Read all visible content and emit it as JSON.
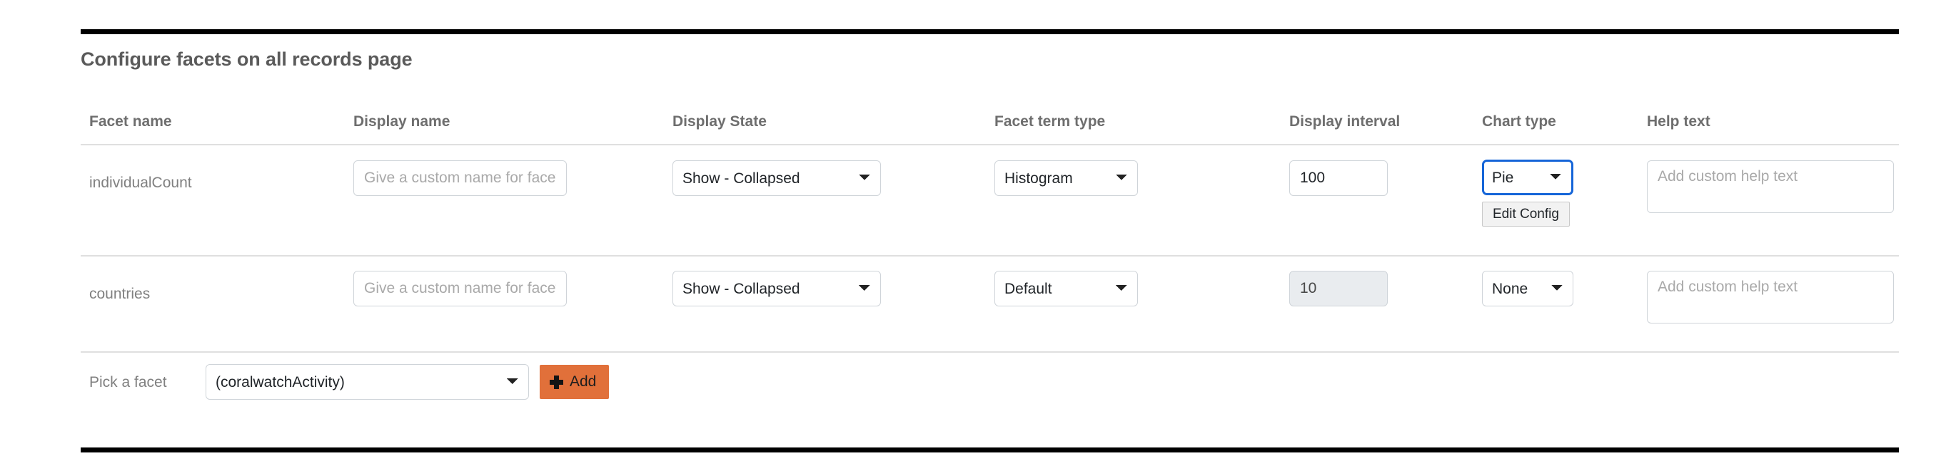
{
  "page": {
    "title": "Configure facets on all records page"
  },
  "table": {
    "columns": [
      {
        "key": "facet_name",
        "label": "Facet name"
      },
      {
        "key": "display_name",
        "label": "Display name"
      },
      {
        "key": "display_state",
        "label": "Display State"
      },
      {
        "key": "facet_term_type",
        "label": "Facet term type"
      },
      {
        "key": "display_interval",
        "label": "Display interval"
      },
      {
        "key": "chart_type",
        "label": "Chart type"
      },
      {
        "key": "help_text",
        "label": "Help text"
      }
    ],
    "rows": [
      {
        "facet_name": "individualCount",
        "display_name": {
          "value": "",
          "placeholder": "Give a custom name for facet."
        },
        "display_state": {
          "selected": "Show - Collapsed"
        },
        "facet_term_type": {
          "selected": "Histogram"
        },
        "display_interval": {
          "value": "100",
          "readonly": false
        },
        "chart_type": {
          "selected": "Pie",
          "focused": true,
          "edit_config_label": "Edit Config"
        },
        "help_text": {
          "value": "",
          "placeholder": "Add custom help text"
        }
      },
      {
        "facet_name": "countries",
        "display_name": {
          "value": "",
          "placeholder": "Give a custom name for facet."
        },
        "display_state": {
          "selected": "Show - Collapsed"
        },
        "facet_term_type": {
          "selected": "Default"
        },
        "display_interval": {
          "value": "10",
          "readonly": true
        },
        "chart_type": {
          "selected": "None",
          "focused": false,
          "edit_config_label": ""
        },
        "help_text": {
          "value": "",
          "placeholder": "Add custom help text"
        }
      }
    ]
  },
  "footer": {
    "pick_label": "Pick a facet",
    "pick_selected": "(coralwatchActivity)",
    "add_label": "Add",
    "add_icon": "plus-icon"
  },
  "colors": {
    "accent_orange": "#e1703a",
    "focus_blue": "#1565d8",
    "rule_black": "#000000",
    "separator_gray": "#dfdfdf",
    "heading_gray": "#5a5a5a",
    "muted_gray": "#808080",
    "readonly_bg": "#e9ecef"
  }
}
